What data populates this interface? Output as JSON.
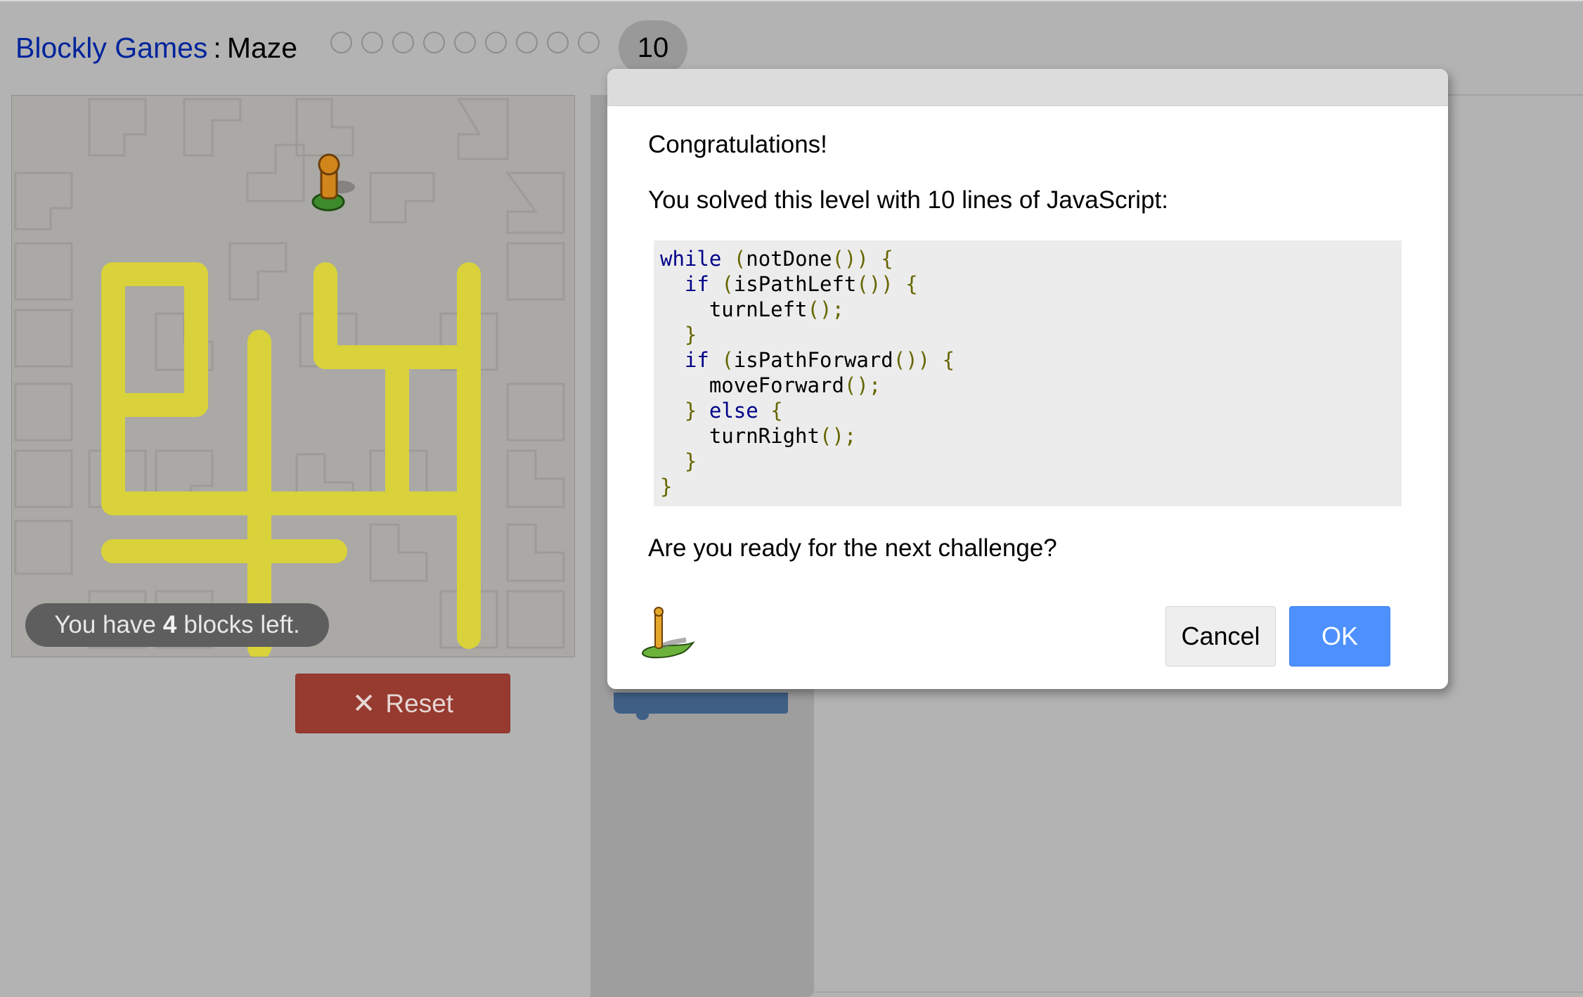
{
  "header": {
    "app_link": "Blockly Games",
    "separator": ":",
    "game_title": "Maze",
    "level_count_before_current": 9,
    "current_level": "10"
  },
  "maze": {
    "capacity_prefix": "You have",
    "capacity_count": "4",
    "capacity_suffix": "blocks left.",
    "path_color": "#d9d23a",
    "background_color": "#aaa9a6"
  },
  "controls": {
    "reset_label": "Reset",
    "reset_icon": "x-icon",
    "reset_color": "#973a30"
  },
  "dialog": {
    "congrats": "Congratulations!",
    "solved_text": "You solved this level with 10 lines of JavaScript:",
    "code_lines": [
      [
        {
          "t": "while",
          "c": "kw"
        },
        {
          "t": " ",
          "c": ""
        },
        {
          "t": "(",
          "c": "pun"
        },
        {
          "t": "notDone",
          "c": ""
        },
        {
          "t": "()) {",
          "c": "pun"
        }
      ],
      [
        {
          "t": "  ",
          "c": ""
        },
        {
          "t": "if",
          "c": "kw"
        },
        {
          "t": " ",
          "c": ""
        },
        {
          "t": "(",
          "c": "pun"
        },
        {
          "t": "isPathLeft",
          "c": ""
        },
        {
          "t": "()) {",
          "c": "pun"
        }
      ],
      [
        {
          "t": "    ",
          "c": ""
        },
        {
          "t": "turnLeft",
          "c": ""
        },
        {
          "t": "();",
          "c": "pun"
        }
      ],
      [
        {
          "t": "  ",
          "c": ""
        },
        {
          "t": "}",
          "c": "pun"
        }
      ],
      [
        {
          "t": "  ",
          "c": ""
        },
        {
          "t": "if",
          "c": "kw"
        },
        {
          "t": " ",
          "c": ""
        },
        {
          "t": "(",
          "c": "pun"
        },
        {
          "t": "isPathForward",
          "c": ""
        },
        {
          "t": "()) {",
          "c": "pun"
        }
      ],
      [
        {
          "t": "    ",
          "c": ""
        },
        {
          "t": "moveForward",
          "c": ""
        },
        {
          "t": "();",
          "c": "pun"
        }
      ],
      [
        {
          "t": "  ",
          "c": ""
        },
        {
          "t": "}",
          "c": "pun"
        },
        {
          "t": " ",
          "c": ""
        },
        {
          "t": "else",
          "c": "kw"
        },
        {
          "t": " ",
          "c": ""
        },
        {
          "t": "{",
          "c": "pun"
        }
      ],
      [
        {
          "t": "    ",
          "c": ""
        },
        {
          "t": "turnRight",
          "c": ""
        },
        {
          "t": "();",
          "c": "pun"
        }
      ],
      [
        {
          "t": "  ",
          "c": ""
        },
        {
          "t": "}",
          "c": "pun"
        }
      ],
      [
        {
          "t": "}",
          "c": "pun"
        }
      ]
    ],
    "ready_text": "Are you ready for the next challenge?",
    "cancel_label": "Cancel",
    "ok_label": "OK",
    "ok_color": "#4d90fe"
  }
}
